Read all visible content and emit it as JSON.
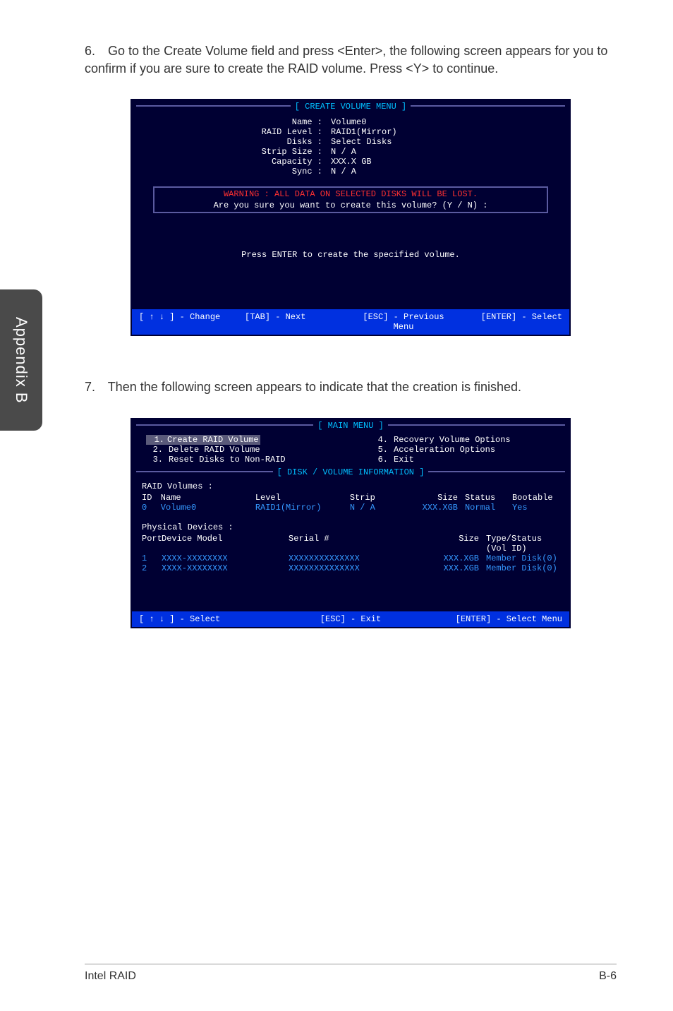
{
  "sideTab": "Appendix B",
  "para6": {
    "num": "6.",
    "text": "Go to the Create Volume field and press <Enter>, the following screen appears for you to confirm if you are sure to create the RAID volume. Press <Y> to continue."
  },
  "para7": {
    "num": "7.",
    "text": "Then the following screen appears to indicate that the creation is finished."
  },
  "bios1": {
    "title": "[  CREATE VOLUME MENU  ]",
    "fields": {
      "name_k": "Name :",
      "name_v": "Volume0",
      "raid_k": "RAID Level :",
      "raid_v": "RAID1(Mirror)",
      "disks_k": "Disks :",
      "disks_v": "Select Disks",
      "strip_k": "Strip Size :",
      "strip_v": "N / A",
      "cap_k": "Capacity :",
      "cap_v": "XXX.X  GB",
      "sync_k": "Sync :",
      "sync_v": "N / A"
    },
    "warn_red": "WARNING :  ALL DATA ON SELECTED DISKS WILL BE LOST.",
    "warn_white": "Are  you  sure  you  want  to  create  this  volume?   (Y / N)  :",
    "instr": "Press  ENTER  to  create  the  specified  volume.",
    "footer": {
      "a": "[ ↑ ↓ ] - Change",
      "b": "[TAB] - Next",
      "c": "[ESC] - Previous Menu",
      "d": "[ENTER] - Select"
    }
  },
  "bios2": {
    "title_main": "[   MAIN  MENU   ]",
    "menu": {
      "l1n": "1.",
      "l1": "Create  RAID  Volume",
      "r1n": "4.",
      "r1": "Recovery Volume  Options",
      "l2n": "2.",
      "l2": "Delete  RAID  Volume",
      "r2n": "5.",
      "r2": "Acceleration Options",
      "l3n": "3.",
      "l3": "Reset Disks to Non-RAID",
      "r3n": "6.",
      "r3": "Exit"
    },
    "title_info": "[   DISK / VOLUME INFORMATION   ]",
    "raid_label": "RAID  Volumes :",
    "raid_head": {
      "id": "ID",
      "name": "Name",
      "level": "Level",
      "strip": "Strip",
      "size": "Size",
      "status": "Status",
      "boot": "Bootable"
    },
    "raid_row": {
      "id": "0",
      "name": "Volume0",
      "level": "RAID1(Mirror)",
      "strip": "N / A",
      "size": "XXX.XGB",
      "status": "Normal",
      "boot": "Yes"
    },
    "phys_label": "Physical  Devices :",
    "phys_head": {
      "port": "Port",
      "model": "Device  Model",
      "serial": "Serial  #",
      "size": "Size",
      "type": "Type/Status (Vol  ID)"
    },
    "phys_rows": [
      {
        "port": "1",
        "model": "XXXX-XXXXXXXX",
        "serial": "XXXXXXXXXXXXXX",
        "size": "XXX.XGB",
        "type": "Member  Disk(0)"
      },
      {
        "port": "2",
        "model": "XXXX-XXXXXXXX",
        "serial": "XXXXXXXXXXXXXX",
        "size": "XXX.XGB",
        "type": "Member  Disk(0)"
      }
    ],
    "footer": {
      "a": "[ ↑ ↓ ] - Select",
      "b": "[ESC] - Exit",
      "c": "[ENTER] - Select Menu"
    }
  },
  "pageFooter": {
    "left": "Intel RAID",
    "right": "B-6"
  }
}
